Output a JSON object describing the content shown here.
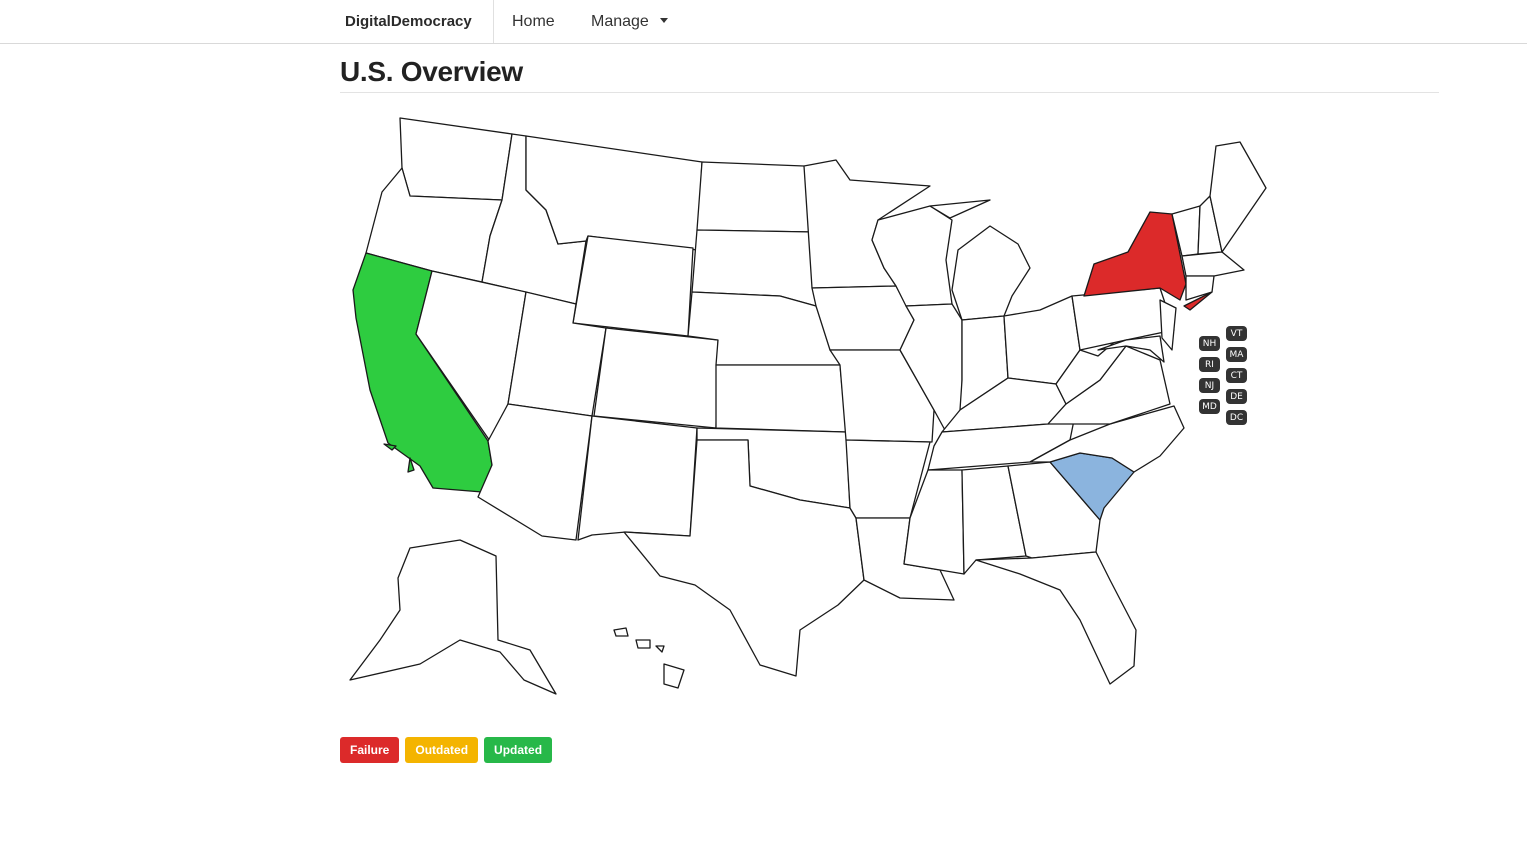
{
  "navbar": {
    "brand": "DigitalDemocracy",
    "home": "Home",
    "manage": "Manage"
  },
  "page": {
    "title": "U.S. Overview"
  },
  "map": {
    "status_colors": {
      "default": "#ffffff",
      "updated": "#2ecc40",
      "failure": "#dc2a2a",
      "selected": "#8bb4de"
    },
    "highlighted_states": {
      "CA": "updated",
      "NY": "failure",
      "SC": "selected"
    },
    "small_state_labels": [
      "VT",
      "NH",
      "MA",
      "RI",
      "CT",
      "NJ",
      "DE",
      "MD",
      "DC"
    ]
  },
  "legend": [
    {
      "label": "Failure",
      "color": "#dc2a2a"
    },
    {
      "label": "Outdated",
      "color": "#f4b400"
    },
    {
      "label": "Updated",
      "color": "#27b849"
    }
  ]
}
